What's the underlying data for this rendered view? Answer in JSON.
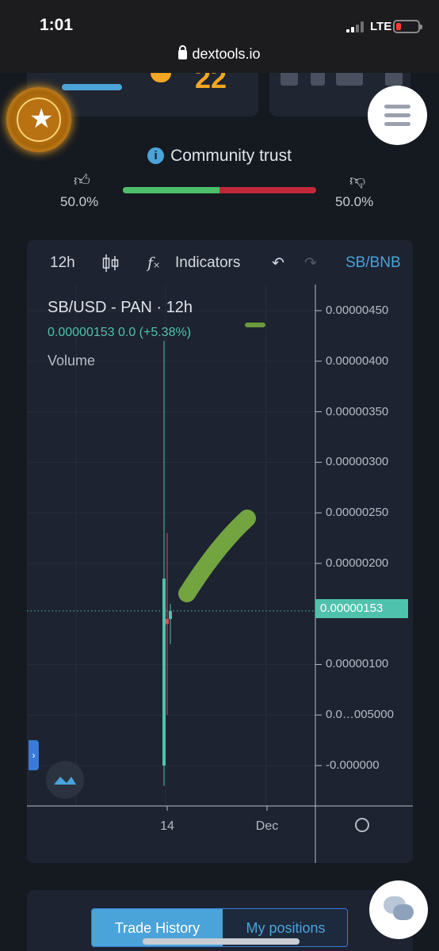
{
  "status_bar": {
    "time": "1:01",
    "network": "LTE"
  },
  "browser": {
    "url": "dextools.io"
  },
  "top_cards": {
    "score": "22"
  },
  "community_trust": {
    "title": "Community trust",
    "likes_pct": "50.0%",
    "dislikes_pct": "50.0%",
    "like_fraction": 0.5,
    "good_color": "#4dbf6a",
    "bad_color": "#c0283a"
  },
  "chart_toolbar": {
    "interval": "12h",
    "indicators_label": "Indicators",
    "pair_label": "SB/BNB"
  },
  "chart_legend": {
    "ticker": "SB/USD - PAN · 12h",
    "quote": "0.00000153 0.0 (+5.38%)",
    "volume_label": "Volume"
  },
  "chart_data": {
    "type": "candlestick",
    "title": "SB/USD - PAN · 12h",
    "y_tick_labels": [
      "0.00000450",
      "0.00000400",
      "0.00000350",
      "0.00000300",
      "0.00000250",
      "0.00000200",
      "0.00000153",
      "0.00000100",
      "0.0…005000",
      "-0.000000"
    ],
    "x_tick_labels": [
      "14",
      "Dec"
    ],
    "ylim": [
      -2.5e-07,
      4.7e-06
    ],
    "last_price": 1.53e-06,
    "change_pct": 5.38,
    "candles": [
      {
        "x": "14",
        "open": 1.85e-06,
        "high": 4.2e-06,
        "low": -2e-07,
        "close": 0.0,
        "color": "#4fc2ad"
      },
      {
        "x": "14",
        "open": 1.45e-06,
        "high": 2.3e-06,
        "low": 5e-07,
        "close": 1.4e-06,
        "color": "#e0524f"
      },
      {
        "x": "14",
        "open": 1.45e-06,
        "high": 1.6e-06,
        "low": 1.2e-06,
        "close": 1.53e-06,
        "color": "#4fc2ad"
      }
    ]
  },
  "bottom_tabs": {
    "trade_history": "Trade History",
    "my_positions": "My positions"
  }
}
